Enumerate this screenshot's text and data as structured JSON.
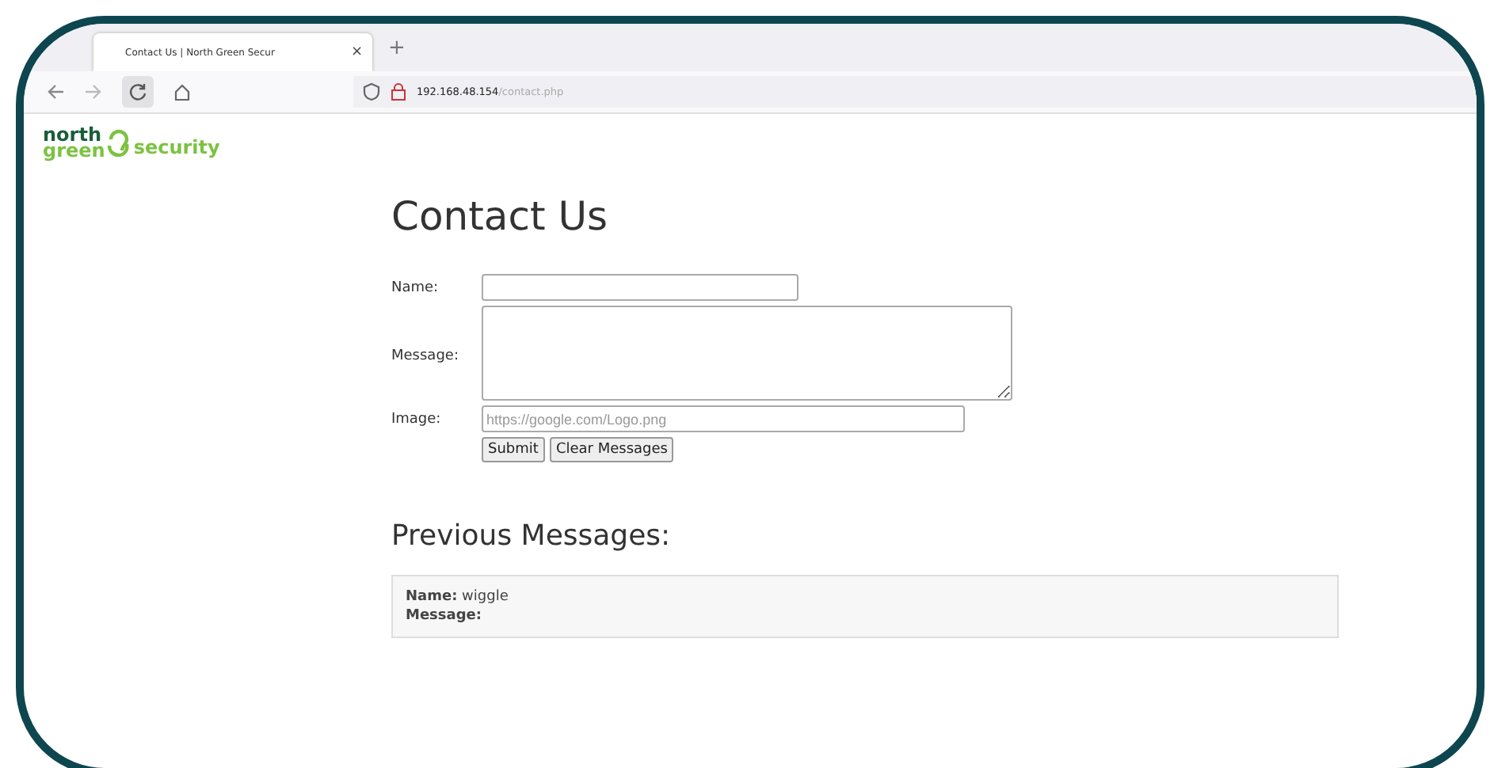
{
  "browser": {
    "tab": {
      "title": "Contact Us | North Green Secur",
      "close": "×"
    },
    "new_tab": "+",
    "url": {
      "host": "192.168.48.154",
      "path": "/contact.php"
    }
  },
  "logo": {
    "top": "north",
    "bottom": "green",
    "suffix": "security"
  },
  "heading": "Contact Us",
  "form": {
    "fields": [
      {
        "kind": "input",
        "label": "Name:"
      },
      {
        "kind": "textarea",
        "label": "Message:"
      },
      {
        "kind": "input",
        "label": "Image:",
        "placeholder": "https://google.com/Logo.png"
      }
    ],
    "buttons": [
      "Submit",
      "Clear Messages"
    ]
  },
  "previous_heading": "Previous Messages:",
  "messages": [
    {
      "name_label": "Name:",
      "name": "wiggle",
      "message_label": "Message:"
    }
  ]
}
